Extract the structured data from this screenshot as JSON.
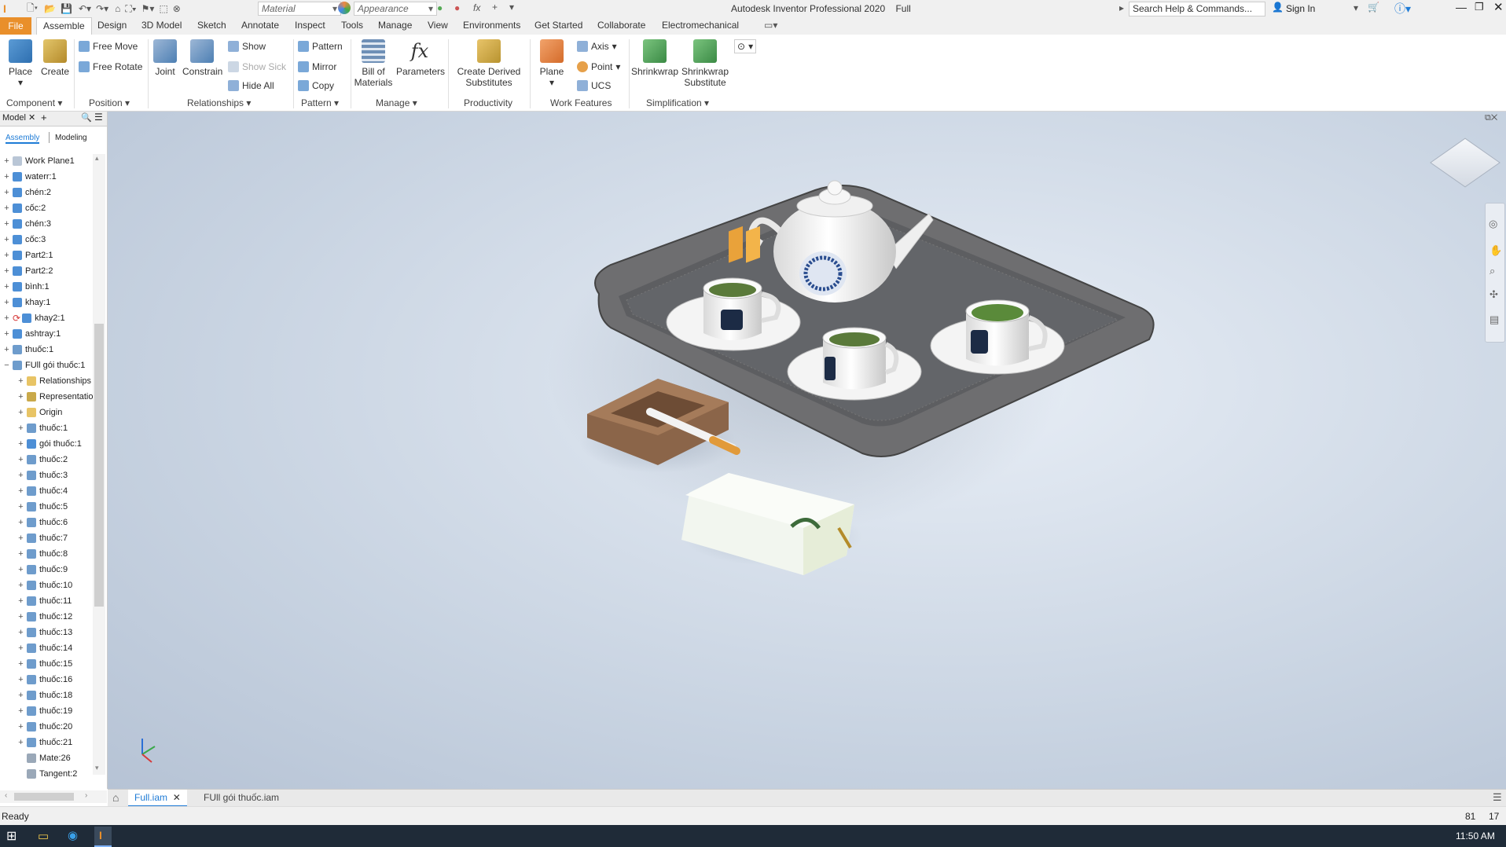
{
  "titlebar": {
    "app_title": "Autodesk Inventor Professional 2020",
    "mode": "Full",
    "material_placeholder": "Material",
    "appearance_placeholder": "Appearance",
    "search_placeholder": "Search Help & Commands...",
    "sign_in": "Sign In"
  },
  "tabs": [
    "File",
    "Assemble",
    "Design",
    "3D Model",
    "Sketch",
    "Annotate",
    "Inspect",
    "Tools",
    "Manage",
    "View",
    "Environments",
    "Get Started",
    "Collaborate",
    "Electromechanical"
  ],
  "ribbon": {
    "place": "Place",
    "create": "Create",
    "free_move": "Free Move",
    "free_rotate": "Free Rotate",
    "joint": "Joint",
    "constrain": "Constrain",
    "show": "Show",
    "show_sick": "Show Sick",
    "hide_all": "Hide All",
    "pattern": "Pattern",
    "mirror": "Mirror",
    "copy": "Copy",
    "bom1": "Bill of",
    "bom2": "Materials",
    "parameters": "Parameters",
    "derived1": "Create Derived",
    "derived2": "Substitutes",
    "plane": "Plane",
    "axis": "Axis",
    "point": "Point",
    "ucs": "UCS",
    "shrinkwrap": "Shrinkwrap",
    "shrink_sub1": "Shrinkwrap",
    "shrink_sub2": "Substitute",
    "groups": {
      "component": "Component",
      "position": "Position",
      "relationships": "Relationships",
      "pattern": "Pattern",
      "manage": "Manage",
      "productivity": "Productivity",
      "work_features": "Work Features",
      "simplification": "Simplification"
    }
  },
  "browser": {
    "title": "Model",
    "subtabs": [
      "Assembly",
      "Modeling"
    ],
    "nodes": [
      {
        "label": "Work Plane1",
        "depth": 0,
        "icon": "plane"
      },
      {
        "label": "waterr:1",
        "depth": 0,
        "icon": "part"
      },
      {
        "label": "chén:2",
        "depth": 0,
        "icon": "part"
      },
      {
        "label": "cốc:2",
        "depth": 0,
        "icon": "part"
      },
      {
        "label": "chén:3",
        "depth": 0,
        "icon": "part"
      },
      {
        "label": "cốc:3",
        "depth": 0,
        "icon": "part"
      },
      {
        "label": "Part2:1",
        "depth": 0,
        "icon": "part"
      },
      {
        "label": "Part2:2",
        "depth": 0,
        "icon": "part"
      },
      {
        "label": "bình:1",
        "depth": 0,
        "icon": "part"
      },
      {
        "label": "khay:1",
        "depth": 0,
        "icon": "part"
      },
      {
        "label": "khay2:1",
        "depth": 0,
        "icon": "part-refresh"
      },
      {
        "label": "ashtray:1",
        "depth": 0,
        "icon": "part"
      },
      {
        "label": "thuốc:1",
        "depth": 0,
        "icon": "assembly"
      },
      {
        "label": "FUll gói thuốc:1",
        "depth": 0,
        "icon": "assembly",
        "expanded": true
      },
      {
        "label": "Relationships",
        "depth": 1,
        "icon": "folder"
      },
      {
        "label": "Representations",
        "depth": 1,
        "icon": "folder-rep"
      },
      {
        "label": "Origin",
        "depth": 1,
        "icon": "folder"
      },
      {
        "label": "thuốc:1",
        "depth": 1,
        "icon": "assembly"
      },
      {
        "label": "gói thuốc:1",
        "depth": 1,
        "icon": "part"
      },
      {
        "label": "thuốc:2",
        "depth": 1,
        "icon": "assembly"
      },
      {
        "label": "thuốc:3",
        "depth": 1,
        "icon": "assembly"
      },
      {
        "label": "thuốc:4",
        "depth": 1,
        "icon": "assembly"
      },
      {
        "label": "thuốc:5",
        "depth": 1,
        "icon": "assembly"
      },
      {
        "label": "thuốc:6",
        "depth": 1,
        "icon": "assembly"
      },
      {
        "label": "thuốc:7",
        "depth": 1,
        "icon": "assembly"
      },
      {
        "label": "thuốc:8",
        "depth": 1,
        "icon": "assembly"
      },
      {
        "label": "thuốc:9",
        "depth": 1,
        "icon": "assembly"
      },
      {
        "label": "thuốc:10",
        "depth": 1,
        "icon": "assembly"
      },
      {
        "label": "thuốc:11",
        "depth": 1,
        "icon": "assembly"
      },
      {
        "label": "thuốc:12",
        "depth": 1,
        "icon": "assembly"
      },
      {
        "label": "thuốc:13",
        "depth": 1,
        "icon": "assembly"
      },
      {
        "label": "thuốc:14",
        "depth": 1,
        "icon": "assembly"
      },
      {
        "label": "thuốc:15",
        "depth": 1,
        "icon": "assembly"
      },
      {
        "label": "thuốc:16",
        "depth": 1,
        "icon": "assembly"
      },
      {
        "label": "thuốc:18",
        "depth": 1,
        "icon": "assembly"
      },
      {
        "label": "thuốc:19",
        "depth": 1,
        "icon": "assembly"
      },
      {
        "label": "thuốc:20",
        "depth": 1,
        "icon": "assembly"
      },
      {
        "label": "thuốc:21",
        "depth": 1,
        "icon": "assembly"
      },
      {
        "label": "Mate:26",
        "depth": 1,
        "icon": "mate",
        "leaf": true
      },
      {
        "label": "Tangent:2",
        "depth": 1,
        "icon": "tangent",
        "leaf": true
      }
    ]
  },
  "doctabs": {
    "tab1": "Full.iam",
    "tab2": "FUll gói thuốc.iam"
  },
  "status": {
    "text": "Ready",
    "count1": "81",
    "count2": "17"
  },
  "taskbar": {
    "time": "11:50 AM"
  },
  "colors": {
    "file_tab": "#e98f2a",
    "accent": "#1e7bd6",
    "viewport_bg": "#c9d4e2"
  }
}
